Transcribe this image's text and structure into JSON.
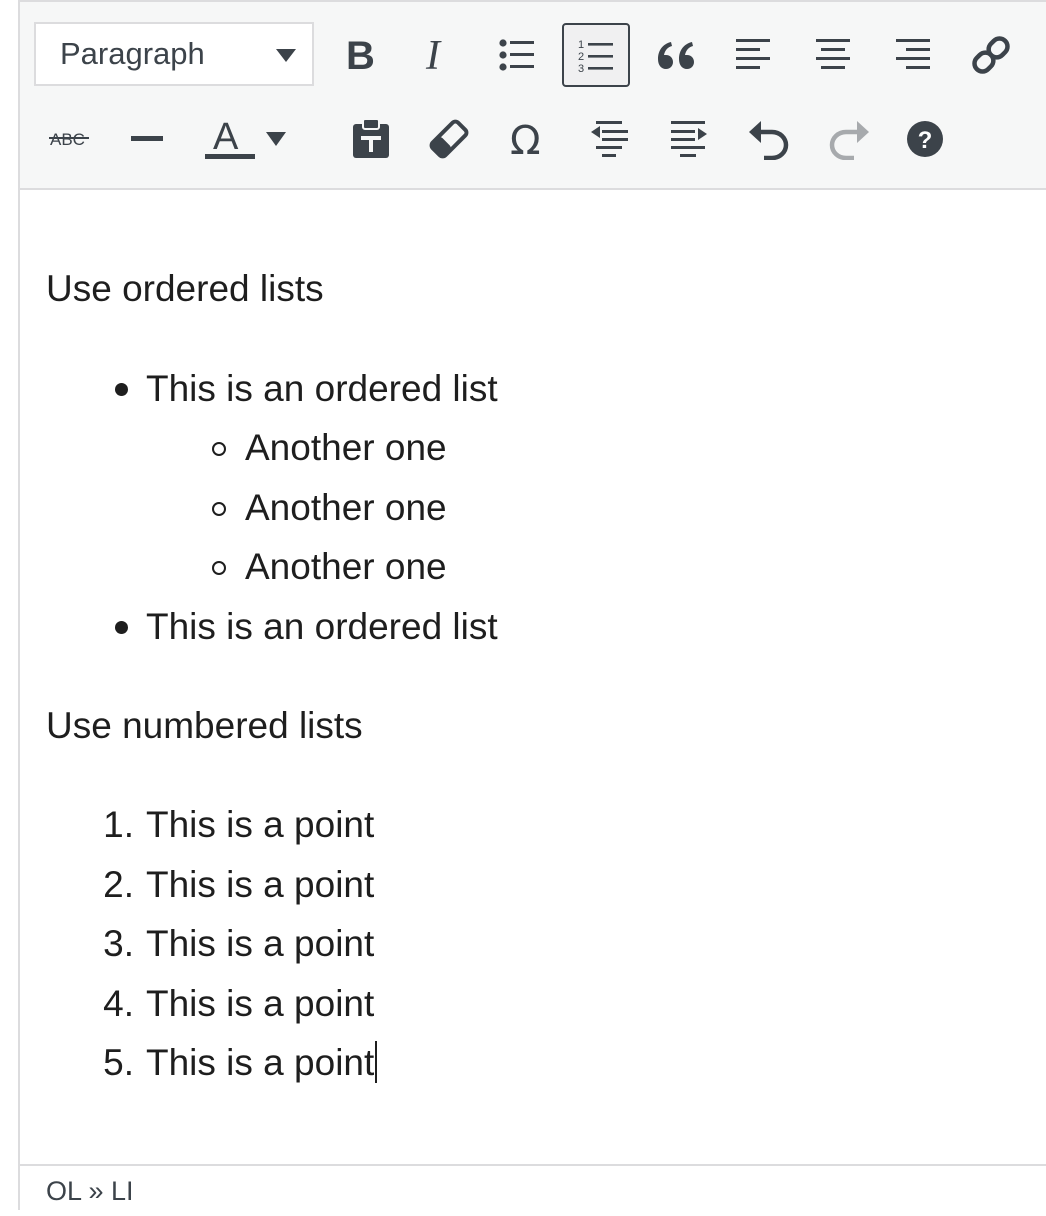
{
  "toolbar": {
    "format_select": {
      "value": "Paragraph"
    },
    "row1": [
      {
        "name": "bold-button",
        "icon": "bold-icon"
      },
      {
        "name": "italic-button",
        "icon": "italic-icon"
      },
      {
        "name": "bulleted-list-button",
        "icon": "bulleted-list-icon"
      },
      {
        "name": "numbered-list-button",
        "icon": "numbered-list-icon",
        "active": true
      },
      {
        "name": "blockquote-button",
        "icon": "blockquote-icon"
      },
      {
        "name": "align-left-button",
        "icon": "align-left-icon"
      },
      {
        "name": "align-center-button",
        "icon": "align-center-icon"
      },
      {
        "name": "align-right-button",
        "icon": "align-right-icon"
      },
      {
        "name": "insert-link-button",
        "icon": "link-icon"
      }
    ],
    "row2": [
      {
        "name": "strikethrough-button",
        "icon": "strikethrough-icon"
      },
      {
        "name": "horizontal-line-button",
        "icon": "horizontal-line-icon"
      },
      {
        "name": "text-color-button",
        "icon": "text-color-icon"
      },
      {
        "name": "paste-as-text-button",
        "icon": "paste-text-icon"
      },
      {
        "name": "clear-formatting-button",
        "icon": "eraser-icon"
      },
      {
        "name": "special-character-button",
        "icon": "omega-icon"
      },
      {
        "name": "decrease-indent-button",
        "icon": "outdent-icon"
      },
      {
        "name": "increase-indent-button",
        "icon": "indent-icon"
      },
      {
        "name": "undo-button",
        "icon": "undo-icon"
      },
      {
        "name": "redo-button",
        "icon": "redo-icon",
        "disabled": true
      },
      {
        "name": "help-button",
        "icon": "help-icon"
      }
    ],
    "strikethrough_glyph": "ABC",
    "text_color_glyph": "A"
  },
  "content": {
    "heading1": "Use ordered lists",
    "bullet_list": [
      {
        "text": "This is an ordered list",
        "children": [
          "Another one",
          "Another one",
          "Another one"
        ]
      },
      {
        "text": "This is an ordered list",
        "children": []
      }
    ],
    "heading2": "Use numbered lists",
    "numbered_list": [
      "This is a point",
      "This is a point",
      "This is a point",
      "This is a point",
      "This is a point"
    ],
    "numbered_markers": [
      "1.",
      "2.",
      "3.",
      "4.",
      "5."
    ]
  },
  "statusbar": {
    "path": "OL » LI"
  },
  "colors": {
    "toolbar_bg": "#f6f7f7",
    "icon": "#3c434a",
    "disabled_icon": "#a7aaad",
    "text": "#1e1e1e"
  }
}
